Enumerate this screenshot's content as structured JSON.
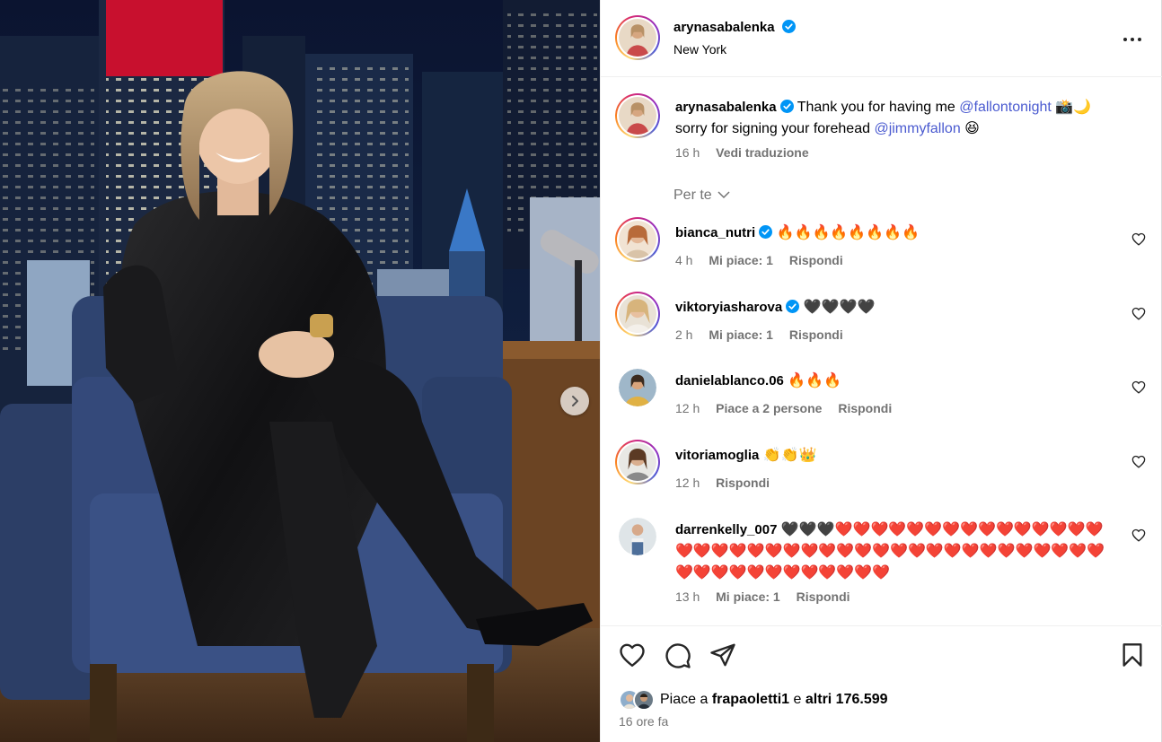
{
  "post": {
    "author": "arynasabalenka",
    "location": "New York",
    "caption": {
      "text": "Thank you for having me",
      "mention1": "@fallontonight",
      "after_mention1": "📸🌙",
      "line2": "sorry for signing your forehead",
      "mention2": "@jimmyfallon",
      "emoji": "😆",
      "time": "16 h",
      "translate": "Vedi traduzione"
    },
    "filter_label": "Per te"
  },
  "comments": [
    {
      "user": "bianca_nutri",
      "verified": true,
      "text": "🔥🔥🔥🔥🔥🔥🔥🔥",
      "time": "4 h",
      "likes": "Mi piace: 1",
      "reply": "Rispondi"
    },
    {
      "user": "viktoryiasharova",
      "verified": true,
      "text": "🖤🖤🖤🖤",
      "time": "2 h",
      "likes": "Mi piace: 1",
      "reply": "Rispondi"
    },
    {
      "user": "danielablanco.06",
      "verified": false,
      "text": "🔥🔥🔥",
      "time": "12 h",
      "likes": "Piace a 2 persone",
      "reply": "Rispondi"
    },
    {
      "user": "vitoriamoglia",
      "verified": false,
      "text": "👏👏👑",
      "time": "12 h",
      "likes": "",
      "reply": "Rispondi"
    },
    {
      "user": "darrenkelly_007",
      "verified": false,
      "text": "🖤🖤🖤❤️❤️❤️❤️❤️❤️❤️❤️❤️❤️❤️❤️❤️❤️❤️❤️❤️❤️❤️❤️❤️❤️❤️❤️❤️❤️❤️❤️❤️❤️❤️❤️❤️❤️❤️❤️❤️❤️❤️❤️❤️❤️❤️❤️❤️❤️❤️❤️❤️❤️❤️",
      "time": "13 h",
      "likes": "Mi piace: 1",
      "reply": "Rispondi"
    }
  ],
  "footer": {
    "likes_prefix": "Piace a",
    "likes_user": "frapaoletti1",
    "likes_joiner": "e",
    "likes_others": "altri 176.599",
    "ago": "16 ore fa"
  },
  "colors": {
    "mention": "#4b5bd0",
    "verified": "#0095f6",
    "muted": "#737373"
  },
  "icons": [
    "next-arrow-icon",
    "more-options-icon",
    "verified-badge-icon",
    "chevron-down-icon",
    "heart-icon",
    "comment-icon",
    "share-icon",
    "bookmark-icon"
  ]
}
